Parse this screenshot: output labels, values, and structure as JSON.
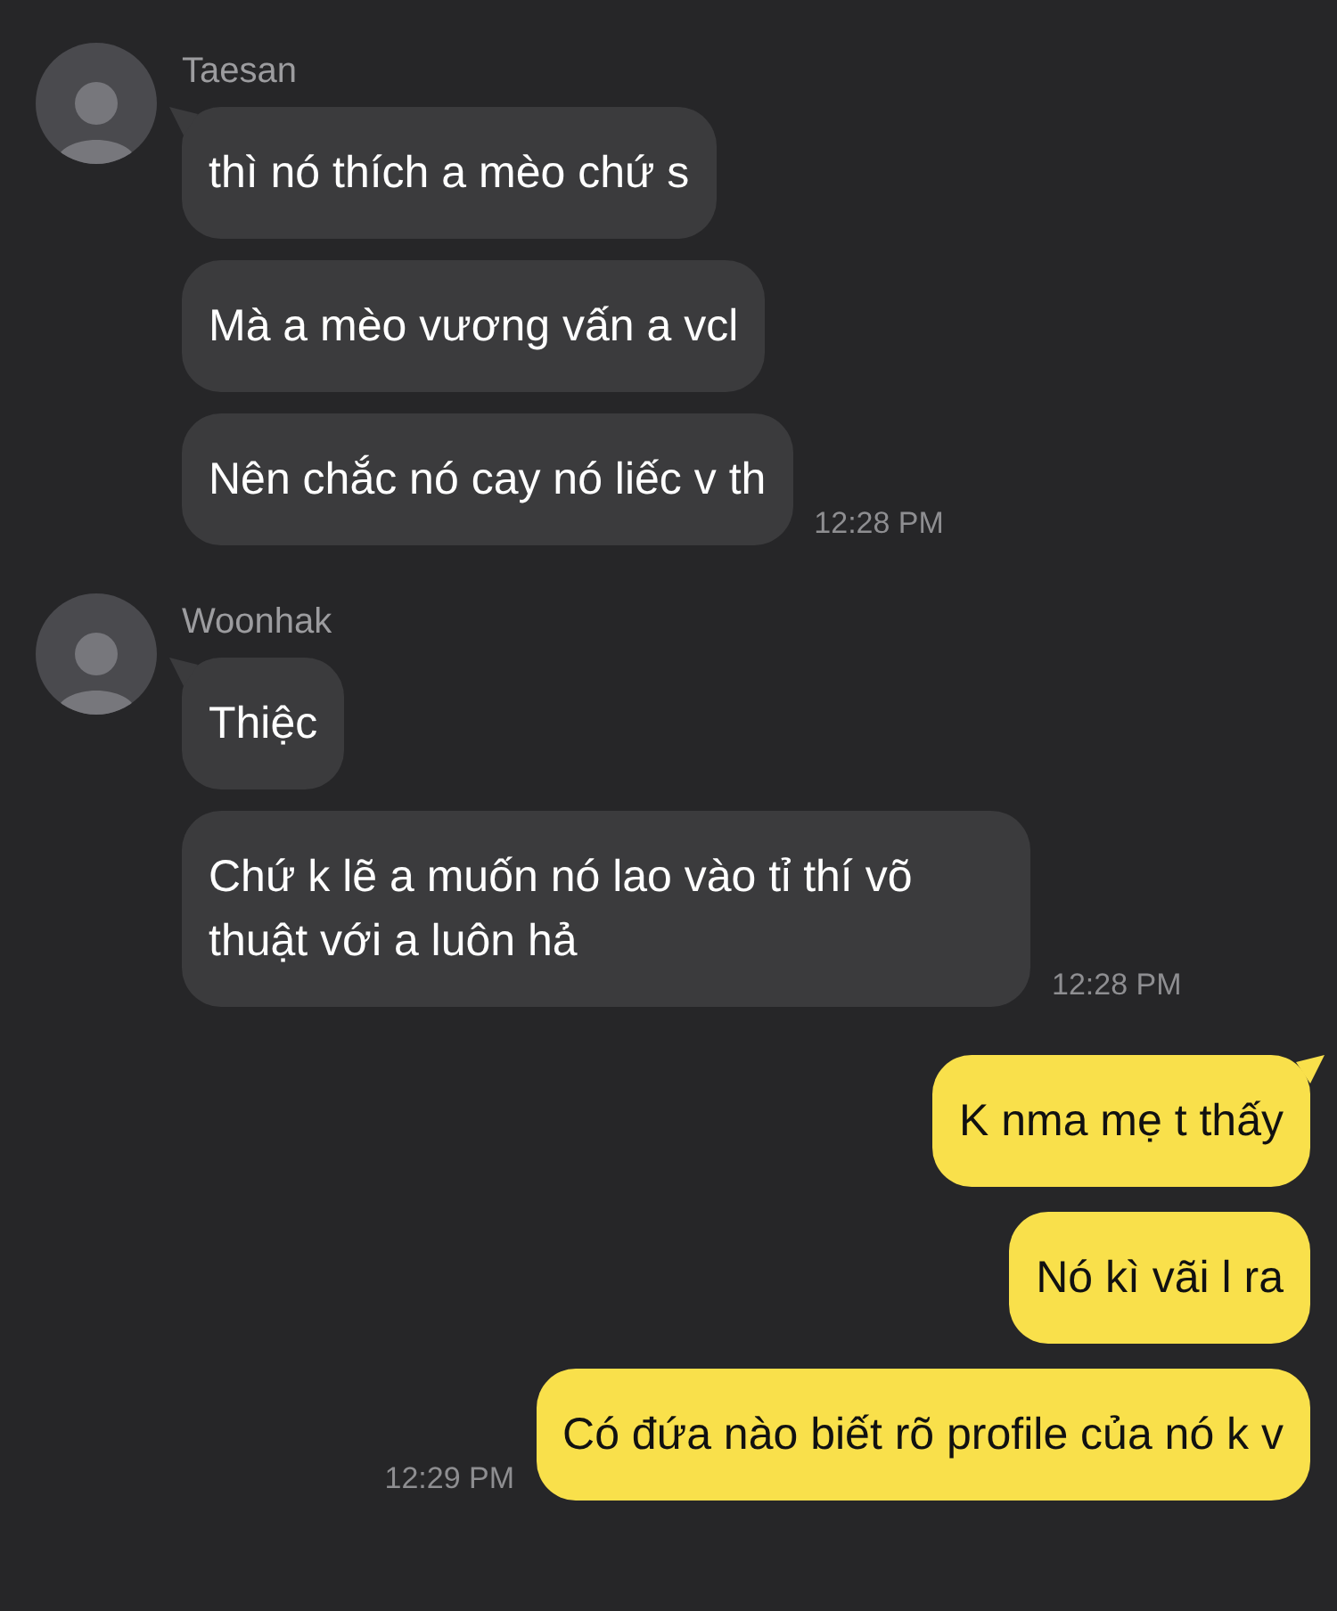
{
  "groups": [
    {
      "kind": "incoming",
      "sender": "Taesan",
      "messages": [
        {
          "text": "thì nó thích a mèo chứ s"
        },
        {
          "text": "Mà a mèo vương vấn a vcl"
        },
        {
          "text": "Nên chắc nó cay nó liếc v th"
        }
      ],
      "time": "12:28 PM"
    },
    {
      "kind": "incoming",
      "sender": "Woonhak",
      "messages": [
        {
          "text": "Thiệc"
        },
        {
          "text": "Chứ k lẽ a muốn nó lao vào tỉ thí võ thuật với a luôn hả"
        }
      ],
      "time": "12:28 PM"
    },
    {
      "kind": "outgoing",
      "messages": [
        {
          "text": "K nma mẹ t thấy"
        },
        {
          "text": "Nó kì vãi l ra"
        },
        {
          "text": "Có đứa nào biết rõ profile của nó k v"
        }
      ],
      "time": "12:29 PM"
    }
  ]
}
